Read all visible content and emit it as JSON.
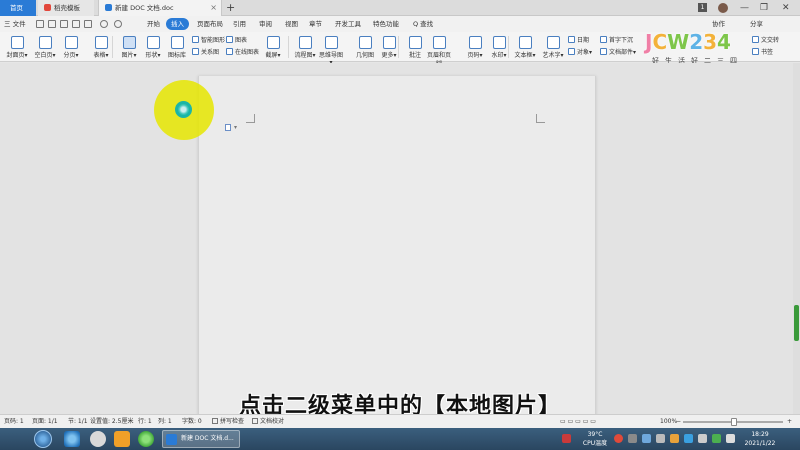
{
  "tabs": {
    "home": "首页",
    "templates": "稻壳模板",
    "document": "新建 DOC 文档.doc",
    "new_tab": "+",
    "badge": "1"
  },
  "window_controls": {
    "minimize": "—",
    "restore": "❐",
    "close": "✕"
  },
  "menu": {
    "file": "三 文件",
    "items": [
      "开始",
      "插入",
      "页面布局",
      "引用",
      "审阅",
      "视图",
      "章节",
      "开发工具",
      "特色功能",
      "Q 查找"
    ],
    "active_index": 1,
    "right": {
      "collab": "协作",
      "share": "分享"
    }
  },
  "ribbon": {
    "large": [
      {
        "label": "封面页▾"
      },
      {
        "label": "空白页▾"
      },
      {
        "label": "分页▾"
      },
      {
        "label": "表格▾"
      },
      {
        "label": "图片▾"
      },
      {
        "label": "形状▾"
      },
      {
        "label": "图标库"
      },
      {
        "label": "截屏▾"
      },
      {
        "label": "流程图▾"
      },
      {
        "label": "思维导图▾"
      },
      {
        "label": "几何图"
      },
      {
        "label": "更多▾"
      },
      {
        "label": "批注"
      },
      {
        "label": "页眉和页脚"
      },
      {
        "label": "页码▾"
      },
      {
        "label": "水印▾"
      },
      {
        "label": "文本框▾"
      },
      {
        "label": "艺术字▾"
      }
    ],
    "small": [
      {
        "label": "智能图形"
      },
      {
        "label": "关系图"
      },
      {
        "label": "图表"
      },
      {
        "label": "在线图表"
      },
      {
        "label": "日期"
      },
      {
        "label": "首字下沉"
      },
      {
        "label": "对象▾"
      },
      {
        "label": "文档部件▾"
      },
      {
        "label": "文交转"
      },
      {
        "label": "书签"
      }
    ],
    "selected_index": 4
  },
  "watermark": {
    "logo": [
      "J",
      "C",
      "W",
      "2",
      "3",
      "4"
    ],
    "subtitle": "好生活好二三四"
  },
  "subtitle_caption": "点击二级菜单中的【本地图片】",
  "status": {
    "page": "页码: 1",
    "pages": "页面: 1/1",
    "section": "节: 1/1",
    "setting": "设置值: 2.5厘米",
    "row": "行: 1",
    "col": "列: 1",
    "words": "字数: 0",
    "spell": "拼写检查",
    "proof": "文档校对",
    "zoom": "100%",
    "zoom_minus": "−",
    "zoom_plus": "+"
  },
  "taskbar": {
    "task_label": "新建 DOC 文档.d...",
    "temperature": "39°C",
    "cpu_label": "CPU温度",
    "time": "18:29",
    "date": "2021/1/22"
  },
  "colors": {
    "accent": "#2a7bd6",
    "cursor_halo": "#e6e600",
    "scroll_thumb": "#3a9a3a"
  }
}
